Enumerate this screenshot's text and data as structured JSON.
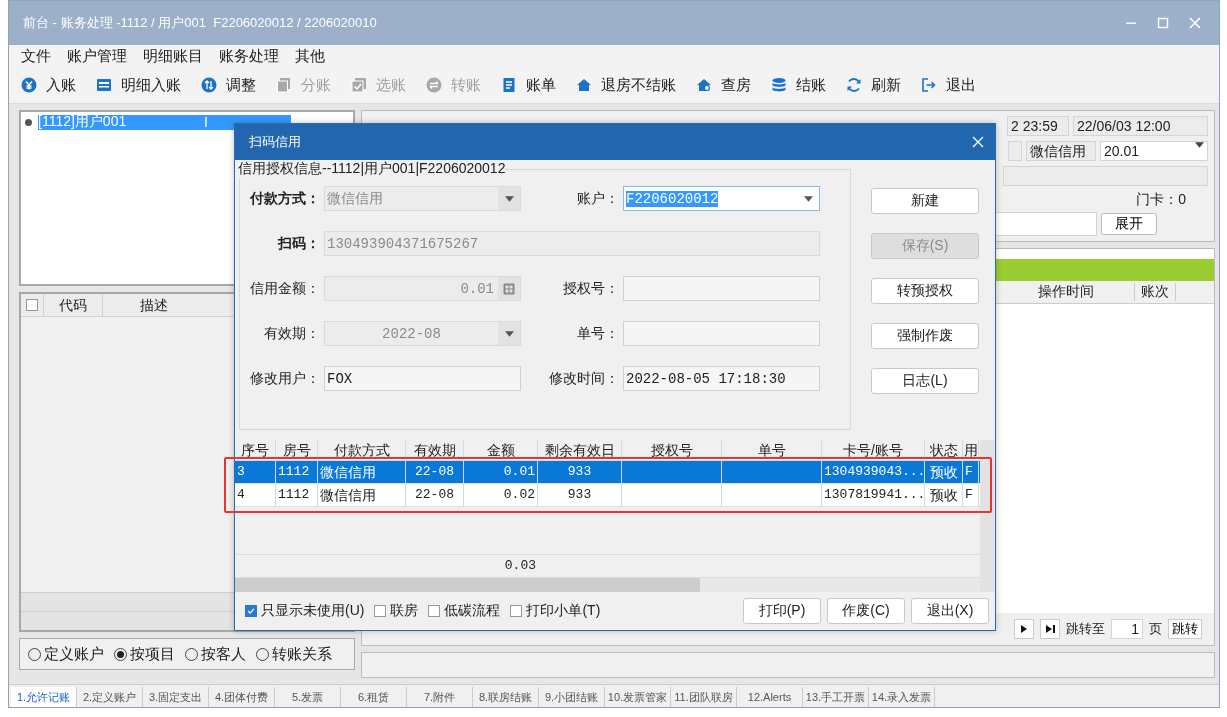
{
  "window": {
    "title": "前台 - 账务处理 -1112 / 用户001  F2206020012 / 2206020010"
  },
  "menu": [
    "文件",
    "账户管理",
    "明细账目",
    "账务处理",
    "其他"
  ],
  "toolbar": [
    {
      "label": "入账",
      "disabled": false
    },
    {
      "label": "明细入账",
      "disabled": false
    },
    {
      "label": "调整",
      "disabled": false
    },
    {
      "label": "分账",
      "disabled": true
    },
    {
      "label": "选账",
      "disabled": true
    },
    {
      "label": "转账",
      "disabled": true
    },
    {
      "label": "账单",
      "disabled": false
    },
    {
      "label": "退房不结账",
      "disabled": false
    },
    {
      "label": "查房",
      "disabled": false
    },
    {
      "label": "结账",
      "disabled": false
    },
    {
      "label": "刷新",
      "disabled": false
    },
    {
      "label": "退出",
      "disabled": false
    }
  ],
  "account_list": [
    {
      "name": "[1112]用户001",
      "flag": "I",
      "selected": true
    }
  ],
  "item_table": {
    "columns": [
      "代码",
      "描述"
    ],
    "all_checked": false
  },
  "view_options": [
    {
      "label": "定义账户",
      "selected": false
    },
    {
      "label": "按项目",
      "selected": true
    },
    {
      "label": "按客人",
      "selected": false
    },
    {
      "label": "转账关系",
      "selected": false
    }
  ],
  "right_panel": {
    "time_from": "2 23:59",
    "time_to": "22/06/03 12:00",
    "payment_label": "微信信用",
    "payment_amount": "20.01",
    "door_card": "门卡：0",
    "expand_button": "展开",
    "columns": [
      "操作时间",
      "账次"
    ],
    "jump_label": "跳转至",
    "page_value": "1",
    "page_unit": "页",
    "jump_button": "跳转"
  },
  "bottom_tabs": [
    {
      "label": "1.允许记账",
      "selected": true
    },
    {
      "label": "2.定义账户",
      "selected": false
    },
    {
      "label": "3.固定支出",
      "selected": false
    },
    {
      "label": "4.团体付费",
      "selected": false
    },
    {
      "label": "5.发票",
      "selected": false
    },
    {
      "label": "6.租赁",
      "selected": false
    },
    {
      "label": "7.附件",
      "selected": false
    },
    {
      "label": "8.联房结账",
      "selected": false
    },
    {
      "label": "9.小团结账",
      "selected": false
    },
    {
      "label": "10.发票管家",
      "selected": false
    },
    {
      "label": "11.团队联房",
      "selected": false
    },
    {
      "label": "12.Alerts",
      "selected": false
    },
    {
      "label": "13.手工开票",
      "selected": false
    },
    {
      "label": "14.录入发票",
      "selected": false
    }
  ],
  "dialog": {
    "title": "扫码信用",
    "group_title": "信用授权信息--1112|用户001|F2206020012",
    "form_rows": [
      [
        {
          "label": "付款方式：",
          "kind": "dropdown",
          "value": "微信信用",
          "disabled": true,
          "bold": true,
          "focused": false
        },
        {
          "label": "账户：",
          "kind": "dropdown",
          "value": "F2206020012",
          "disabled": false,
          "bold": false,
          "focused": true
        }
      ],
      [
        {
          "label": "扫码：",
          "kind": "text",
          "value": "130493904371675267",
          "disabled": true,
          "bold": true,
          "focused": false
        }
      ],
      [
        {
          "label": "信用金额：",
          "kind": "number",
          "value": "0.01",
          "disabled": true,
          "bold": false,
          "focused": false
        },
        {
          "label": "授权号：",
          "kind": "text",
          "bold": false,
          "focused": false
        }
      ],
      [
        {
          "label": "有效期：",
          "kind": "month",
          "value": "2022-08",
          "disabled": true,
          "bold": false,
          "focused": false
        },
        {
          "label": "单号：",
          "kind": "text",
          "bold": false,
          "focused": false
        }
      ],
      [
        {
          "label": "修改用户：",
          "kind": "text",
          "value": "FOX",
          "disabled": false,
          "bold": false,
          "focused": false
        },
        {
          "label": "修改时间：",
          "kind": "text",
          "value": "2022-08-05 17:18:30",
          "disabled": false,
          "bold": false,
          "focused": false
        }
      ]
    ],
    "side_buttons": [
      {
        "label": "新建",
        "disabled": false
      },
      {
        "label": "保存(S)",
        "disabled": true
      },
      {
        "label": "转预授权",
        "disabled": false
      },
      {
        "label": "强制作废",
        "disabled": false
      },
      {
        "label": "日志(L)",
        "disabled": false
      }
    ],
    "grid": {
      "columns": [
        "序号",
        "房号",
        "付款方式",
        "有效期",
        "金额",
        "剩余有效日",
        "授权号",
        "单号",
        "卡号/账号",
        "状态",
        "用"
      ],
      "rows": [
        {
          "selected": true,
          "cells": [
            "3",
            "1112",
            "微信信用",
            "22-08",
            "0.01",
            "933",
            null,
            null,
            "1304939043...",
            "预收",
            "F"
          ]
        },
        {
          "selected": false,
          "cells": [
            "4",
            "1112",
            "微信信用",
            "22-08",
            "0.02",
            "933",
            null,
            null,
            "1307819941...",
            "预收",
            "F"
          ]
        }
      ],
      "total": "0.03",
      "highlight_box": true
    },
    "options": [
      {
        "label": "只显示未使用(U)",
        "checked": true
      },
      {
        "label": "联房",
        "checked": false
      },
      {
        "label": "低碳流程",
        "checked": false
      },
      {
        "label": "打印小单(T)",
        "checked": false
      }
    ],
    "buttons": [
      "打印(P)",
      "作废(C)",
      "退出(X)"
    ]
  }
}
